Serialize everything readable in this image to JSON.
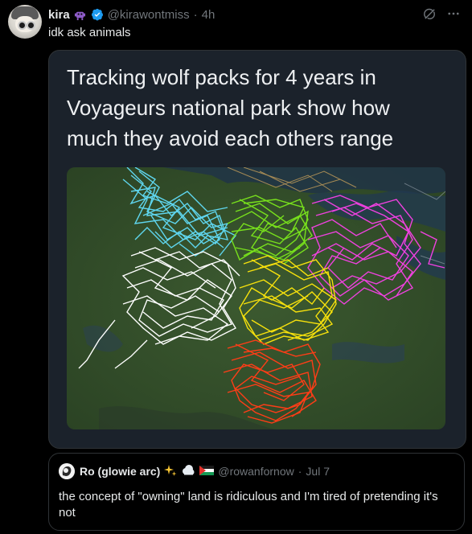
{
  "post": {
    "display_name": "kira",
    "handle": "@kirawontmiss",
    "separator": "·",
    "time": "4h",
    "text": "idk ask animals"
  },
  "media": {
    "caption": "Tracking wolf packs for 4 years in Voyageurs national park show how much they avoid each others range",
    "pack_colors": [
      "#5fd6ef",
      "#78e11c",
      "#f041e0",
      "#ffffff",
      "#f7e10c",
      "#ff3d17"
    ]
  },
  "quote": {
    "display_name": "Ro (glowie arc)",
    "handle": "@rowanfornow",
    "separator": "·",
    "time": "Jul 7",
    "text": "the concept of \"owning\" land is ridiculous and I'm tired of pretending it's not"
  },
  "icons": {
    "verified": "verified-badge-icon",
    "more": "more-options-icon",
    "grok": "grok-icon"
  },
  "colors": {
    "background": "#000000",
    "text_primary": "#e7e9ea",
    "text_secondary": "#71767b",
    "verified_blue": "#1d9bf0",
    "border": "#2f3336"
  }
}
